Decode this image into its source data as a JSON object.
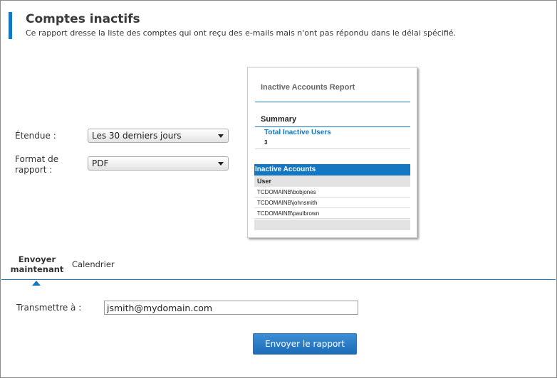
{
  "header": {
    "title": "Comptes inactifs",
    "subtitle": "Ce rapport dresse la liste des comptes qui ont reçu des e-mails mais n'ont pas répondu dans le délai spécifié."
  },
  "form": {
    "scope_label": "Étendue :",
    "scope_value": "Les 30 derniers jours",
    "format_label_line1": "Format de",
    "format_label_line2": "rapport :",
    "format_value": "PDF"
  },
  "preview": {
    "title": "Inactive Accounts Report",
    "summary_heading": "Summary",
    "total_label": "Total Inactive Users",
    "total_value": "3",
    "section_heading": "Inactive Accounts",
    "column_header": "User",
    "rows": [
      "TCDOMAINB\\bobjones",
      "TCDOMAINB\\johnsmith",
      "TCDOMAINB\\paulbrown"
    ]
  },
  "tabs": {
    "send_now_line1": "Envoyer",
    "send_now_line2": "maintenant",
    "schedule": "Calendrier"
  },
  "delivery": {
    "to_label": "Transmettre à :",
    "to_value": "jsmith@mydomain.com"
  },
  "actions": {
    "send_report": "Envoyer le rapport"
  },
  "colors": {
    "accent": "#1377c3",
    "button": "#2a7cc7"
  }
}
